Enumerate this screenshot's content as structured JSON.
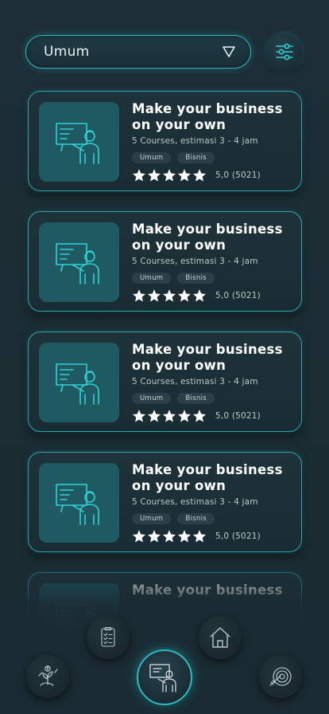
{
  "filter": {
    "selected": "Umum"
  },
  "courses": [
    {
      "title": "Make your business on your own",
      "meta": "5 Courses, estimasi 3 - 4 jam",
      "tags": [
        "Umum",
        "Bisnis"
      ],
      "rating_value": 5,
      "rating_text": "5,0 (5021)"
    },
    {
      "title": "Make your business on your own",
      "meta": "5 Courses, estimasi 3 - 4 jam",
      "tags": [
        "Umum",
        "Bisnis"
      ],
      "rating_value": 5,
      "rating_text": "5,0 (5021)"
    },
    {
      "title": "Make your business on your own",
      "meta": "5 Courses, estimasi 3 - 4 jam",
      "tags": [
        "Umum",
        "Bisnis"
      ],
      "rating_value": 5,
      "rating_text": "5,0 (5021)"
    },
    {
      "title": "Make your business on your own",
      "meta": "5 Courses, estimasi 3 - 4 jam",
      "tags": [
        "Umum",
        "Bisnis"
      ],
      "rating_value": 5,
      "rating_text": "5,0 (5021)"
    },
    {
      "title": "Make your business",
      "meta": "",
      "tags": [],
      "rating_value": null,
      "rating_text": ""
    }
  ],
  "nav": {
    "items": [
      {
        "icon": "money-plant-icon",
        "active": false
      },
      {
        "icon": "checklist-icon",
        "active": false
      },
      {
        "icon": "teacher-board-icon",
        "active": true
      },
      {
        "icon": "home-icon",
        "active": false
      },
      {
        "icon": "target-icon",
        "active": false
      }
    ]
  },
  "colors": {
    "accent": "#2fb9c2",
    "background": "#1b2b33",
    "card": "#1e323a",
    "thumb": "#1f5a62",
    "icon_line": "#33d0d8"
  }
}
